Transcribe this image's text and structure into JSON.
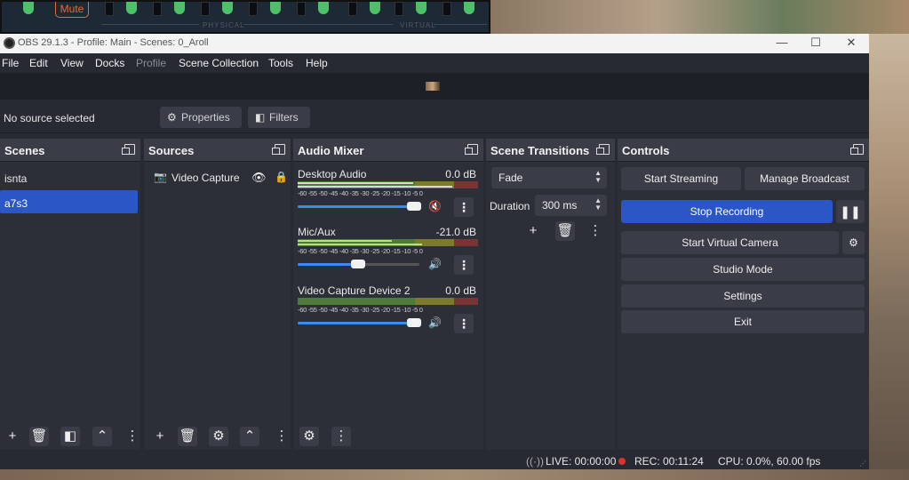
{
  "mini_mixer": {
    "mute_label": "Mute",
    "physical_label": "PHYSICAL",
    "virtual_label": "VIRTUAL"
  },
  "window": {
    "title": "OBS 29.1.3 - Profile: Main - Scenes: 0_Aroll",
    "minimize": "—",
    "maximize": "☐",
    "close": "✕"
  },
  "menu": [
    "File",
    "Edit",
    "View",
    "Docks",
    "Profile",
    "Scene Collection",
    "Tools",
    "Help"
  ],
  "source_toolbar": {
    "no_source": "No source selected",
    "properties": "Properties",
    "filters": "Filters"
  },
  "scenes": {
    "title": "Scenes",
    "items": [
      "isnta",
      "a7s3"
    ],
    "selected": "a7s3"
  },
  "sources": {
    "title": "Sources",
    "items": [
      {
        "name": "Video Capture"
      }
    ]
  },
  "mixer": {
    "title": "Audio Mixer",
    "ticks": "-60 -55 -50 -45 -40 -35 -30 -25 -20 -15 -10 -5 0",
    "channels": [
      {
        "name": "Desktop Audio",
        "db": "0.0 dB",
        "volume": 1.0,
        "muted": true
      },
      {
        "name": "Mic/Aux",
        "db": "-21.0 dB",
        "volume": 0.45,
        "muted": false
      },
      {
        "name": "Video Capture Device 2",
        "db": "0.0 dB",
        "volume": 1.0,
        "muted": false
      }
    ]
  },
  "transitions": {
    "title": "Scene Transitions",
    "selected": "Fade",
    "duration_label": "Duration",
    "duration_value": "300 ms"
  },
  "controls": {
    "title": "Controls",
    "start_streaming": "Start Streaming",
    "manage_broadcast": "Manage Broadcast",
    "stop_recording": "Stop Recording",
    "start_virtual_camera": "Start Virtual Camera",
    "studio_mode": "Studio Mode",
    "settings": "Settings",
    "exit": "Exit"
  },
  "status": {
    "live": "LIVE: 00:00:00",
    "rec": "REC: 00:11:24",
    "cpu": "CPU: 0.0%, 60.00 fps"
  },
  "colors": {
    "accent": "#2b56c6",
    "panel": "#2c2f38",
    "header": "#3a3d47",
    "rec": "#d9342b"
  }
}
